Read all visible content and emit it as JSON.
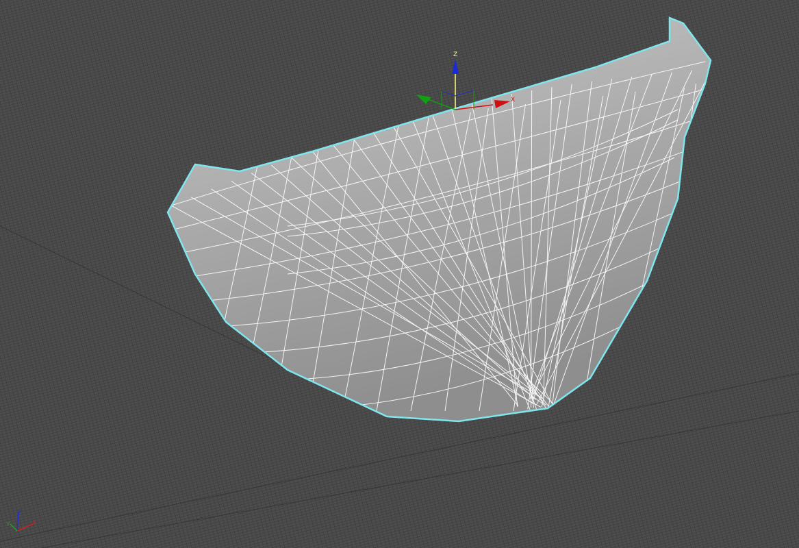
{
  "viewport": {
    "gizmo": {
      "z_label": "Z",
      "x_label": "X"
    },
    "axis_tripod": {
      "x_label": "X",
      "y_label": "Y",
      "z_label": "Z"
    },
    "colors": {
      "background": "#4a4a4a",
      "grid": "#3c3c3c",
      "selection_outline": "#7fe6ee",
      "wire": "#ffffff",
      "x_axis": "#d01010",
      "y_axis": "#10a010",
      "z_axis": "#1020d0",
      "gizmo_active": "#ffff80"
    }
  }
}
